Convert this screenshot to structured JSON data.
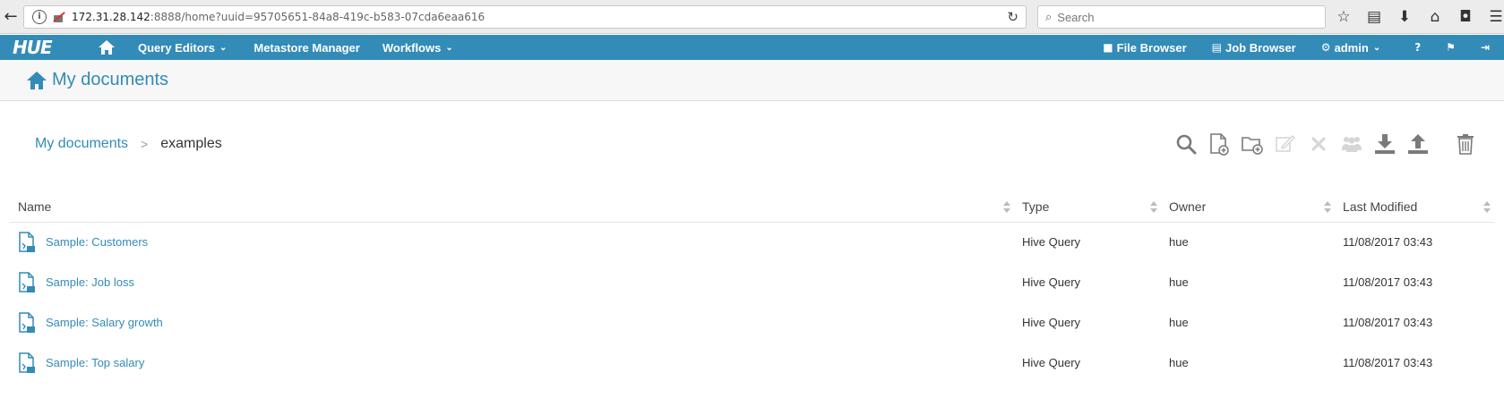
{
  "browser": {
    "url_host": "172.31.28.142",
    "url_rest": ":8888/home?uuid=95705651-84a8-419c-b583-07cda6eaa616",
    "search_placeholder": "Search"
  },
  "nav": {
    "logo": "HUE",
    "items": [
      {
        "label": "Query Editors",
        "dropdown": true
      },
      {
        "label": "Metastore Manager",
        "dropdown": false
      },
      {
        "label": "Workflows",
        "dropdown": true
      }
    ],
    "right": {
      "file_browser": "File Browser",
      "job_browser": "Job Browser",
      "user": "admin"
    }
  },
  "page": {
    "title": "My documents"
  },
  "breadcrumb": {
    "root": "My documents",
    "separator": ">",
    "current": "examples"
  },
  "table": {
    "columns": [
      "Name",
      "Type",
      "Owner",
      "Last Modified"
    ],
    "rows": [
      {
        "name": "Sample: Customers",
        "type": "Hive Query",
        "owner": "hue",
        "modified": "11/08/2017 03:43"
      },
      {
        "name": "Sample: Job loss",
        "type": "Hive Query",
        "owner": "hue",
        "modified": "11/08/2017 03:43"
      },
      {
        "name": "Sample: Salary growth",
        "type": "Hive Query",
        "owner": "hue",
        "modified": "11/08/2017 03:43"
      },
      {
        "name": "Sample: Top salary",
        "type": "Hive Query",
        "owner": "hue",
        "modified": "11/08/2017 03:43"
      }
    ]
  },
  "colors": {
    "brand": "#338bb8",
    "icon_gray": "#7a7a7a",
    "icon_disabled": "#d6d6d6"
  },
  "icons": [
    "search-icon",
    "new-document-icon",
    "new-folder-icon",
    "edit-icon",
    "delete-icon",
    "share-icon",
    "download-icon",
    "upload-icon",
    "trash-icon"
  ]
}
